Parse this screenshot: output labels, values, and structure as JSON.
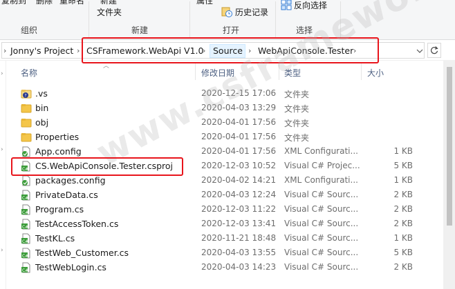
{
  "ribbon": {
    "top_fragments": {
      "copy_to": "复制到",
      "delete": "删除",
      "rename": "重命名",
      "new_item": "新建",
      "new_folder": "文件夹",
      "properties": "属性",
      "history": "历史记录",
      "invert_select": "反向选择"
    },
    "groups": {
      "organize": "组织",
      "new": "新建",
      "open": "打开",
      "select": "选择"
    }
  },
  "address": {
    "crumbs": [
      "Jonny's Project",
      "CSFramework.WebApi V1.0",
      "Source",
      "WebApiConsole.Tester"
    ],
    "active_crumb": "Source"
  },
  "columns": {
    "name": "名称",
    "date": "修改日期",
    "type": "类型",
    "size": "大小"
  },
  "files": [
    {
      "name": ".vs",
      "date": "2020-12-15 17:06",
      "type": "文件夹",
      "size": "",
      "icon": "folder-hidden-icon"
    },
    {
      "name": "bin",
      "date": "2020-04-03 13:29",
      "type": "文件夹",
      "size": "",
      "icon": "folder-icon"
    },
    {
      "name": "obj",
      "date": "2020-04-01 17:56",
      "type": "文件夹",
      "size": "",
      "icon": "folder-icon"
    },
    {
      "name": "Properties",
      "date": "2020-04-01 17:56",
      "type": "文件夹",
      "size": "",
      "icon": "folder-icon"
    },
    {
      "name": "App.config",
      "date": "2020-04-01 17:56",
      "type": "XML Configurati...",
      "size": "1 KB",
      "icon": "config-file-icon"
    },
    {
      "name": "CS.WebApiConsole.Tester.csproj",
      "date": "2020-12-03 10:52",
      "type": "Visual C# Projec...",
      "size": "5 KB",
      "icon": "csproj-file-icon"
    },
    {
      "name": "packages.config",
      "date": "2020-04-02 14:21",
      "type": "XML Configurati...",
      "size": "1 KB",
      "icon": "config-file-icon"
    },
    {
      "name": "PrivateData.cs",
      "date": "2020-04-03 12:24",
      "type": "Visual C# Sourc...",
      "size": "2 KB",
      "icon": "cs-file-icon"
    },
    {
      "name": "Program.cs",
      "date": "2020-12-03 11:22",
      "type": "Visual C# Sourc...",
      "size": "2 KB",
      "icon": "cs-file-icon"
    },
    {
      "name": "TestAccessToken.cs",
      "date": "2020-12-03 13:41",
      "type": "Visual C# Sourc...",
      "size": "2 KB",
      "icon": "cs-file-icon"
    },
    {
      "name": "TestKL.cs",
      "date": "2020-11-21 18:48",
      "type": "Visual C# Sourc...",
      "size": "1 KB",
      "icon": "cs-file-icon"
    },
    {
      "name": "TestWeb_Customer.cs",
      "date": "2020-04-03 13:55",
      "type": "Visual C# Sourc...",
      "size": "5 KB",
      "icon": "cs-file-icon"
    },
    {
      "name": "TestWebLogin.cs",
      "date": "2020-04-03 14:23",
      "type": "Visual C# Sourc...",
      "size": "2 KB",
      "icon": "cs-file-icon"
    }
  ],
  "watermark": "www.csframework.com",
  "colors": {
    "highlight_box": "#e8141b",
    "folder": "#f4c64a",
    "cs_green": "#3c9c3a",
    "header_text": "#4d6082"
  }
}
